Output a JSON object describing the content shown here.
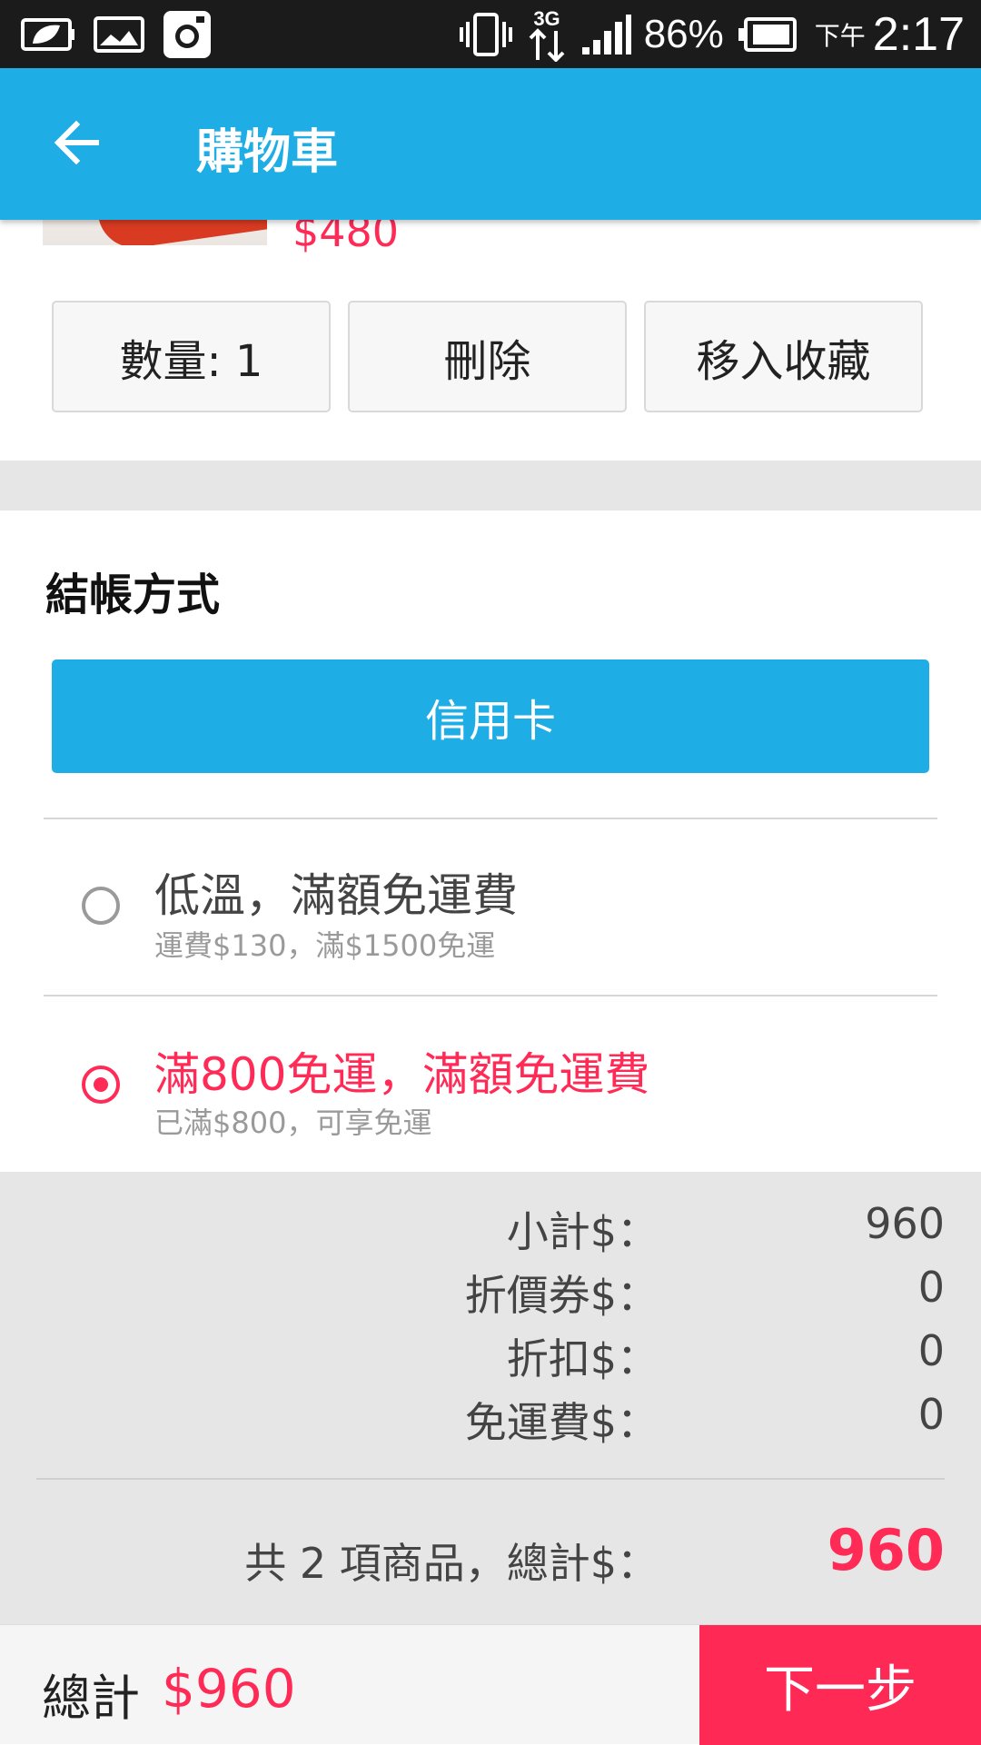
{
  "status_bar": {
    "left_icons": [
      "eco-battery-icon",
      "gallery-icon",
      "instagram-icon"
    ],
    "right_icons": [
      "vibrate-icon",
      "3g-data-icon",
      "signal-icon",
      "battery-icon"
    ],
    "network": "3G",
    "battery_percent": "86%",
    "ampm": "下午",
    "time": "2:17"
  },
  "app_bar": {
    "title": "購物車",
    "back_icon": "arrow-left-icon"
  },
  "product": {
    "price": "$480"
  },
  "item_actions": {
    "quantity": "數量: 1",
    "delete": "刪除",
    "move_to_favorites": "移入收藏"
  },
  "payment": {
    "section_title": "結帳方式",
    "selected_method": "信用卡"
  },
  "shipping_options": [
    {
      "title": "低溫，滿額免運費",
      "subtitle": "運費$130，滿$1500免運",
      "selected": false
    },
    {
      "title": "滿800免運，滿額免運費",
      "subtitle": "已滿$800，可享免運",
      "selected": true
    }
  ],
  "summary": {
    "rows": [
      {
        "label": "小計$：",
        "value": "960"
      },
      {
        "label": "折價券$：",
        "value": "0"
      },
      {
        "label": "折扣$：",
        "value": "0"
      },
      {
        "label": "免運費$：",
        "value": "0"
      }
    ],
    "total_label": "共 2 項商品，總計$：",
    "total_value": "960"
  },
  "bottom_bar": {
    "label": "總計",
    "amount": "$960",
    "next_button": "下一步"
  },
  "colors": {
    "primary_blue": "#1fade6",
    "accent_red": "#ff2a55",
    "status_bar": "#1b1b1b",
    "summary_bg": "#e6e6e6"
  }
}
